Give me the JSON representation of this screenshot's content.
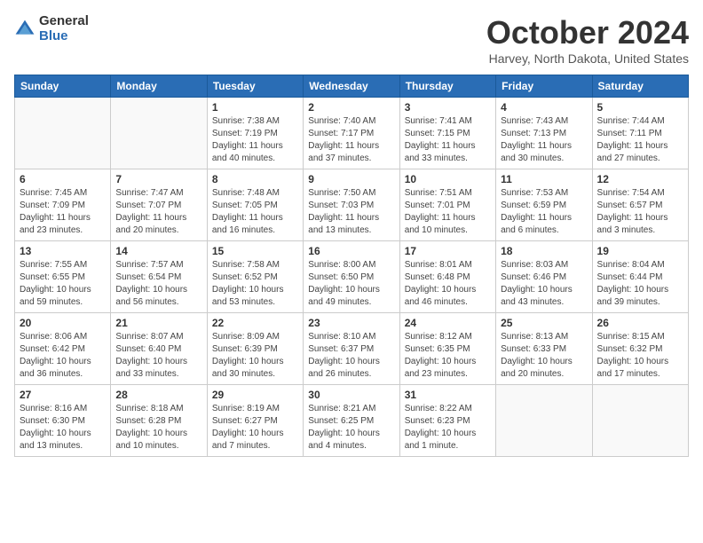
{
  "header": {
    "logo_general": "General",
    "logo_blue": "Blue",
    "month_title": "October 2024",
    "location": "Harvey, North Dakota, United States"
  },
  "weekdays": [
    "Sunday",
    "Monday",
    "Tuesday",
    "Wednesday",
    "Thursday",
    "Friday",
    "Saturday"
  ],
  "weeks": [
    [
      {
        "day": "",
        "info": ""
      },
      {
        "day": "",
        "info": ""
      },
      {
        "day": "1",
        "info": "Sunrise: 7:38 AM\nSunset: 7:19 PM\nDaylight: 11 hours and 40 minutes."
      },
      {
        "day": "2",
        "info": "Sunrise: 7:40 AM\nSunset: 7:17 PM\nDaylight: 11 hours and 37 minutes."
      },
      {
        "day": "3",
        "info": "Sunrise: 7:41 AM\nSunset: 7:15 PM\nDaylight: 11 hours and 33 minutes."
      },
      {
        "day": "4",
        "info": "Sunrise: 7:43 AM\nSunset: 7:13 PM\nDaylight: 11 hours and 30 minutes."
      },
      {
        "day": "5",
        "info": "Sunrise: 7:44 AM\nSunset: 7:11 PM\nDaylight: 11 hours and 27 minutes."
      }
    ],
    [
      {
        "day": "6",
        "info": "Sunrise: 7:45 AM\nSunset: 7:09 PM\nDaylight: 11 hours and 23 minutes."
      },
      {
        "day": "7",
        "info": "Sunrise: 7:47 AM\nSunset: 7:07 PM\nDaylight: 11 hours and 20 minutes."
      },
      {
        "day": "8",
        "info": "Sunrise: 7:48 AM\nSunset: 7:05 PM\nDaylight: 11 hours and 16 minutes."
      },
      {
        "day": "9",
        "info": "Sunrise: 7:50 AM\nSunset: 7:03 PM\nDaylight: 11 hours and 13 minutes."
      },
      {
        "day": "10",
        "info": "Sunrise: 7:51 AM\nSunset: 7:01 PM\nDaylight: 11 hours and 10 minutes."
      },
      {
        "day": "11",
        "info": "Sunrise: 7:53 AM\nSunset: 6:59 PM\nDaylight: 11 hours and 6 minutes."
      },
      {
        "day": "12",
        "info": "Sunrise: 7:54 AM\nSunset: 6:57 PM\nDaylight: 11 hours and 3 minutes."
      }
    ],
    [
      {
        "day": "13",
        "info": "Sunrise: 7:55 AM\nSunset: 6:55 PM\nDaylight: 10 hours and 59 minutes."
      },
      {
        "day": "14",
        "info": "Sunrise: 7:57 AM\nSunset: 6:54 PM\nDaylight: 10 hours and 56 minutes."
      },
      {
        "day": "15",
        "info": "Sunrise: 7:58 AM\nSunset: 6:52 PM\nDaylight: 10 hours and 53 minutes."
      },
      {
        "day": "16",
        "info": "Sunrise: 8:00 AM\nSunset: 6:50 PM\nDaylight: 10 hours and 49 minutes."
      },
      {
        "day": "17",
        "info": "Sunrise: 8:01 AM\nSunset: 6:48 PM\nDaylight: 10 hours and 46 minutes."
      },
      {
        "day": "18",
        "info": "Sunrise: 8:03 AM\nSunset: 6:46 PM\nDaylight: 10 hours and 43 minutes."
      },
      {
        "day": "19",
        "info": "Sunrise: 8:04 AM\nSunset: 6:44 PM\nDaylight: 10 hours and 39 minutes."
      }
    ],
    [
      {
        "day": "20",
        "info": "Sunrise: 8:06 AM\nSunset: 6:42 PM\nDaylight: 10 hours and 36 minutes."
      },
      {
        "day": "21",
        "info": "Sunrise: 8:07 AM\nSunset: 6:40 PM\nDaylight: 10 hours and 33 minutes."
      },
      {
        "day": "22",
        "info": "Sunrise: 8:09 AM\nSunset: 6:39 PM\nDaylight: 10 hours and 30 minutes."
      },
      {
        "day": "23",
        "info": "Sunrise: 8:10 AM\nSunset: 6:37 PM\nDaylight: 10 hours and 26 minutes."
      },
      {
        "day": "24",
        "info": "Sunrise: 8:12 AM\nSunset: 6:35 PM\nDaylight: 10 hours and 23 minutes."
      },
      {
        "day": "25",
        "info": "Sunrise: 8:13 AM\nSunset: 6:33 PM\nDaylight: 10 hours and 20 minutes."
      },
      {
        "day": "26",
        "info": "Sunrise: 8:15 AM\nSunset: 6:32 PM\nDaylight: 10 hours and 17 minutes."
      }
    ],
    [
      {
        "day": "27",
        "info": "Sunrise: 8:16 AM\nSunset: 6:30 PM\nDaylight: 10 hours and 13 minutes."
      },
      {
        "day": "28",
        "info": "Sunrise: 8:18 AM\nSunset: 6:28 PM\nDaylight: 10 hours and 10 minutes."
      },
      {
        "day": "29",
        "info": "Sunrise: 8:19 AM\nSunset: 6:27 PM\nDaylight: 10 hours and 7 minutes."
      },
      {
        "day": "30",
        "info": "Sunrise: 8:21 AM\nSunset: 6:25 PM\nDaylight: 10 hours and 4 minutes."
      },
      {
        "day": "31",
        "info": "Sunrise: 8:22 AM\nSunset: 6:23 PM\nDaylight: 10 hours and 1 minute."
      },
      {
        "day": "",
        "info": ""
      },
      {
        "day": "",
        "info": ""
      }
    ]
  ]
}
